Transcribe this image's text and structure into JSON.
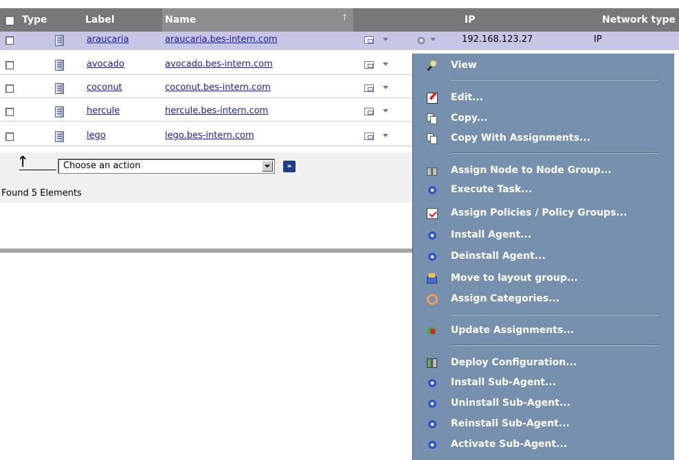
{
  "table": {
    "headers": {
      "type": "Type",
      "label": "Label",
      "name": "Name",
      "ip": "IP",
      "network_type": "Network type"
    },
    "rows": [
      {
        "label": "araucaria",
        "name": "araucaria.bes-intern.com",
        "ip": "192.168.123.27",
        "network_type": "IP",
        "selected": true
      },
      {
        "label": "avocado",
        "name": "avocado.bes-intern.com",
        "ip": "",
        "network_type": "",
        "selected": false
      },
      {
        "label": "coconut",
        "name": "coconut.bes-intern.com",
        "ip": "",
        "network_type": "",
        "selected": false
      },
      {
        "label": "hercule",
        "name": "hercule.bes-intern.com",
        "ip": "",
        "network_type": "",
        "selected": false
      },
      {
        "label": "lego",
        "name": "lego.bes-intern.com",
        "ip": "",
        "network_type": "",
        "selected": false
      }
    ]
  },
  "action_bar": {
    "select_value": "Choose an action",
    "go_label": "»"
  },
  "status": {
    "found_text": "Found 5 Elements"
  },
  "context_menu": {
    "items": [
      {
        "label": "View",
        "icon": "magnifier-icon"
      },
      {
        "label": "Edit...",
        "icon": "edit-icon"
      },
      {
        "label": "Copy...",
        "icon": "copy-icon"
      },
      {
        "label": "Copy With Assignments...",
        "icon": "copy-icon"
      },
      {
        "label": "Assign Node to Node Group...",
        "icon": "node-group-icon"
      },
      {
        "label": "Execute Task...",
        "icon": "gear-icon"
      },
      {
        "label": "Assign Policies / Policy Groups...",
        "icon": "policy-icon"
      },
      {
        "label": "Install Agent...",
        "icon": "gear-icon"
      },
      {
        "label": "Deinstall Agent...",
        "icon": "gear-icon"
      },
      {
        "label": "Move to layout group...",
        "icon": "layout-group-icon"
      },
      {
        "label": "Assign Categories...",
        "icon": "category-icon"
      },
      {
        "label": "Update Assignments...",
        "icon": "update-icon"
      },
      {
        "label": "Deploy Configuration...",
        "icon": "deploy-icon"
      },
      {
        "label": "Install Sub-Agent...",
        "icon": "gear-icon"
      },
      {
        "label": "Uninstall Sub-Agent...",
        "icon": "gear-icon"
      },
      {
        "label": "Reinstall Sub-Agent...",
        "icon": "gear-icon"
      },
      {
        "label": "Activate Sub-Agent...",
        "icon": "gear-icon"
      }
    ]
  },
  "colors": {
    "header_bg": "#787878",
    "selected_row": "#c8c6e6",
    "menu_bg": "#7690ae",
    "link": "#1a1aa0"
  }
}
